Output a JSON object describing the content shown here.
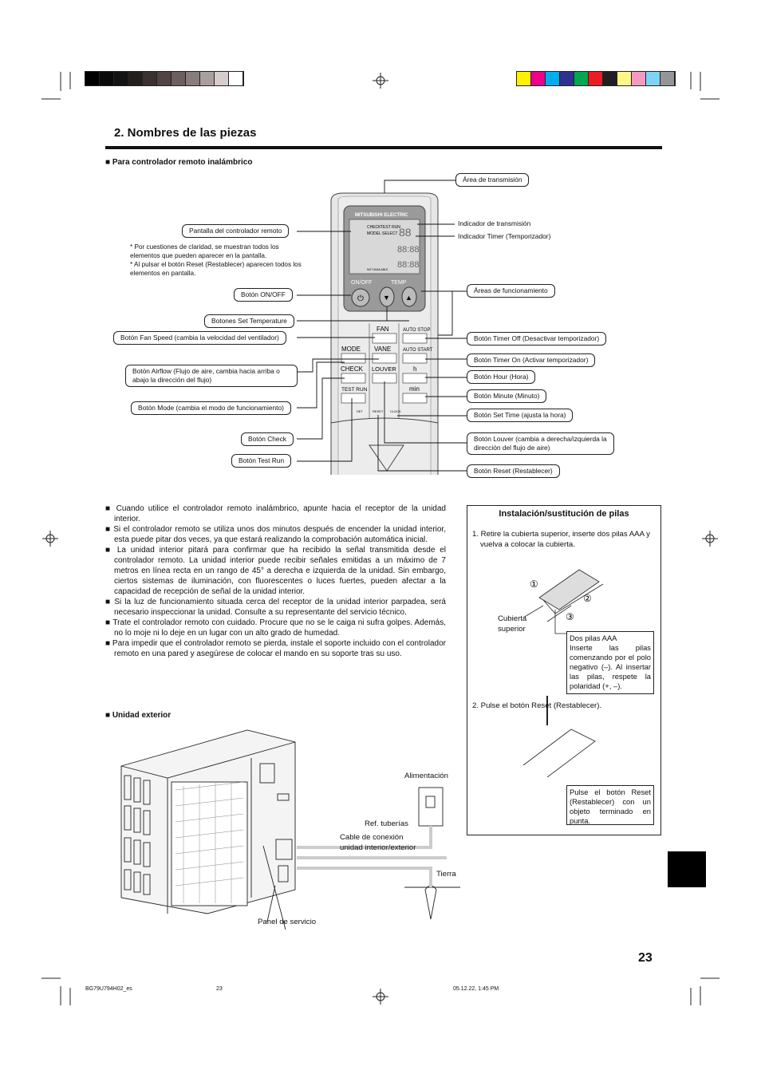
{
  "colors": {
    "gray_bar": [
      "#000000",
      "#0a0a0a",
      "#151212",
      "#241f1c",
      "#3a3230",
      "#504543",
      "#6b605d",
      "#877d7b",
      "#a9a09e",
      "#d5cccb",
      "#ffffff"
    ],
    "cmyk_bar": [
      "#fff200",
      "#ec008c",
      "#00aeef",
      "#2e3192",
      "#00a651",
      "#ed1c24",
      "#231f20",
      "#fff685",
      "#f49ac1",
      "#7fd3f7",
      "#939598"
    ]
  },
  "header": {
    "title": "2. Nombres de las piezas",
    "section_remote": "Para controlador remoto inalámbrico"
  },
  "remote": {
    "brand": "MITSUBISHI ELECTRIC",
    "button_texts": {
      "onoff": "ON/OFF",
      "temp": "TEMP",
      "fan": "FAN",
      "auto_stop": "AUTO STOP",
      "mode": "MODE",
      "vane": "VANE",
      "auto_start": "AUTO START",
      "check": "CHECK",
      "louver": "LOUVER",
      "h": "h",
      "test_run": "TEST RUN",
      "min": "min",
      "set": "SET",
      "reset": "RESET",
      "clock": "CLOCK",
      "lcd_check": "CHECK",
      "lcd_test": "TEST RUN",
      "lcd_model": "MODEL SELECT",
      "lcd_na": "NOT AVAILABLE"
    },
    "labels": {
      "transmission_area": "Área de transmisión",
      "display": "Pantalla del controlador remoto",
      "transmission_indicator": "Indicador de transmisión",
      "timer_indicator": "Indicador Timer (Temporizador)",
      "onoff": "Botón ON/OFF",
      "operation_areas": "Áreas de funcionamiento",
      "set_temp": "Botones Set Temperature",
      "fan_speed": "Botón Fan Speed  (cambia la velocidad del ventilador)",
      "timer_off": "Botón Timer Off (Desactivar temporizador)",
      "timer_on": "Botón Timer On (Activar temporizador)",
      "airflow_1": "Botón Airflow (Flujo de aire, cambia hacia arriba o",
      "airflow_2": "abajo la dirección del flujo)",
      "hour": "Botón Hour (Hora)",
      "minute": "Botón Minute (Minuto)",
      "mode": "Botón Mode (cambia el modo de funcionamiento)",
      "set_time": "Botón  Set Time (ajusta la hora)",
      "check": "Botón Check",
      "louver_1": "Botón  Louver (cambia a derecha/izquierda la",
      "louver_2": "dirección del flujo de aire)",
      "test_run": "Botón Test Run",
      "reset": "Botón Reset (Restablecer)"
    },
    "notes": [
      "* Por cuestiones de claridad, se muestran todos los elementos que pueden aparecer en la pantalla.",
      "* Al pulsar el botón Reset (Restablecer) aparecen todos los elementos en pantalla."
    ]
  },
  "body_paragraphs": [
    "Cuando utilice el controlador remoto inalámbrico, apunte hacia el receptor de la unidad interior.",
    "Si el controlador remoto se utiliza unos dos minutos después de encender la unidad interior, esta puede pitar dos veces, ya que estará realizando la comprobación automática inicial.",
    "La unidad interior pitará para confirmar que ha recibido la señal transmitida desde el controlador remoto. La unidad interior puede recibir señales emitidas a un máximo de 7 metros en línea recta en un rango de 45° a derecha e izquierda de la unidad. Sin embargo, ciertos sistemas de iluminación, con fluorescentes o luces fuertes, pueden afectar a la capacidad de recepción de señal de la unidad interior.",
    "Si la luz de funcionamiento situada cerca del receptor de la unidad interior parpadea, será necesario inspeccionar la unidad. Consulte a su representante del servicio técnico.",
    "Trate el controlador remoto con cuidado. Procure que no se le caiga ni sufra golpes. Además, no lo moje ni lo deje en un lugar con un alto grado de humedad.",
    "Para impedir que el controlador remoto se pierda, instale el soporte incluido con el controlador remoto en una pared y asegúrese de colocar el mando en su soporte tras su uso."
  ],
  "battery": {
    "title": "Instalación/sustitución de pilas",
    "step1": "1. Retire la cubierta superior, inserte dos pilas AAA y vuelva a colocar la cubierta.",
    "markers": [
      "①",
      "②",
      "③"
    ],
    "cover_1": "Cubierta",
    "cover_2": "superior",
    "batteries_title": "Dos pilas AAA",
    "batteries_text": "Inserte las pilas comenzando por el polo negativo (–). Al insertar las pilas, respete la polaridad (+, –).",
    "step2": "2. Pulse el botón Reset (Restablecer).",
    "reset_note": "Pulse el botón Reset (Restablecer) con un objeto terminado en punta."
  },
  "outdoor": {
    "heading": "Unidad exterior",
    "power": "Alimentación",
    "ref_pipes": "Ref. tuberías",
    "cable_1": "Cable de conexión",
    "cable_2": "unidad interior/exterior",
    "earth": "Tierra",
    "service_panel": "Panel de servicio"
  },
  "page_number": "23",
  "footer": {
    "code": "BG79U794H02_es",
    "page": "23",
    "date": "05.12.22, 1:45 PM"
  }
}
